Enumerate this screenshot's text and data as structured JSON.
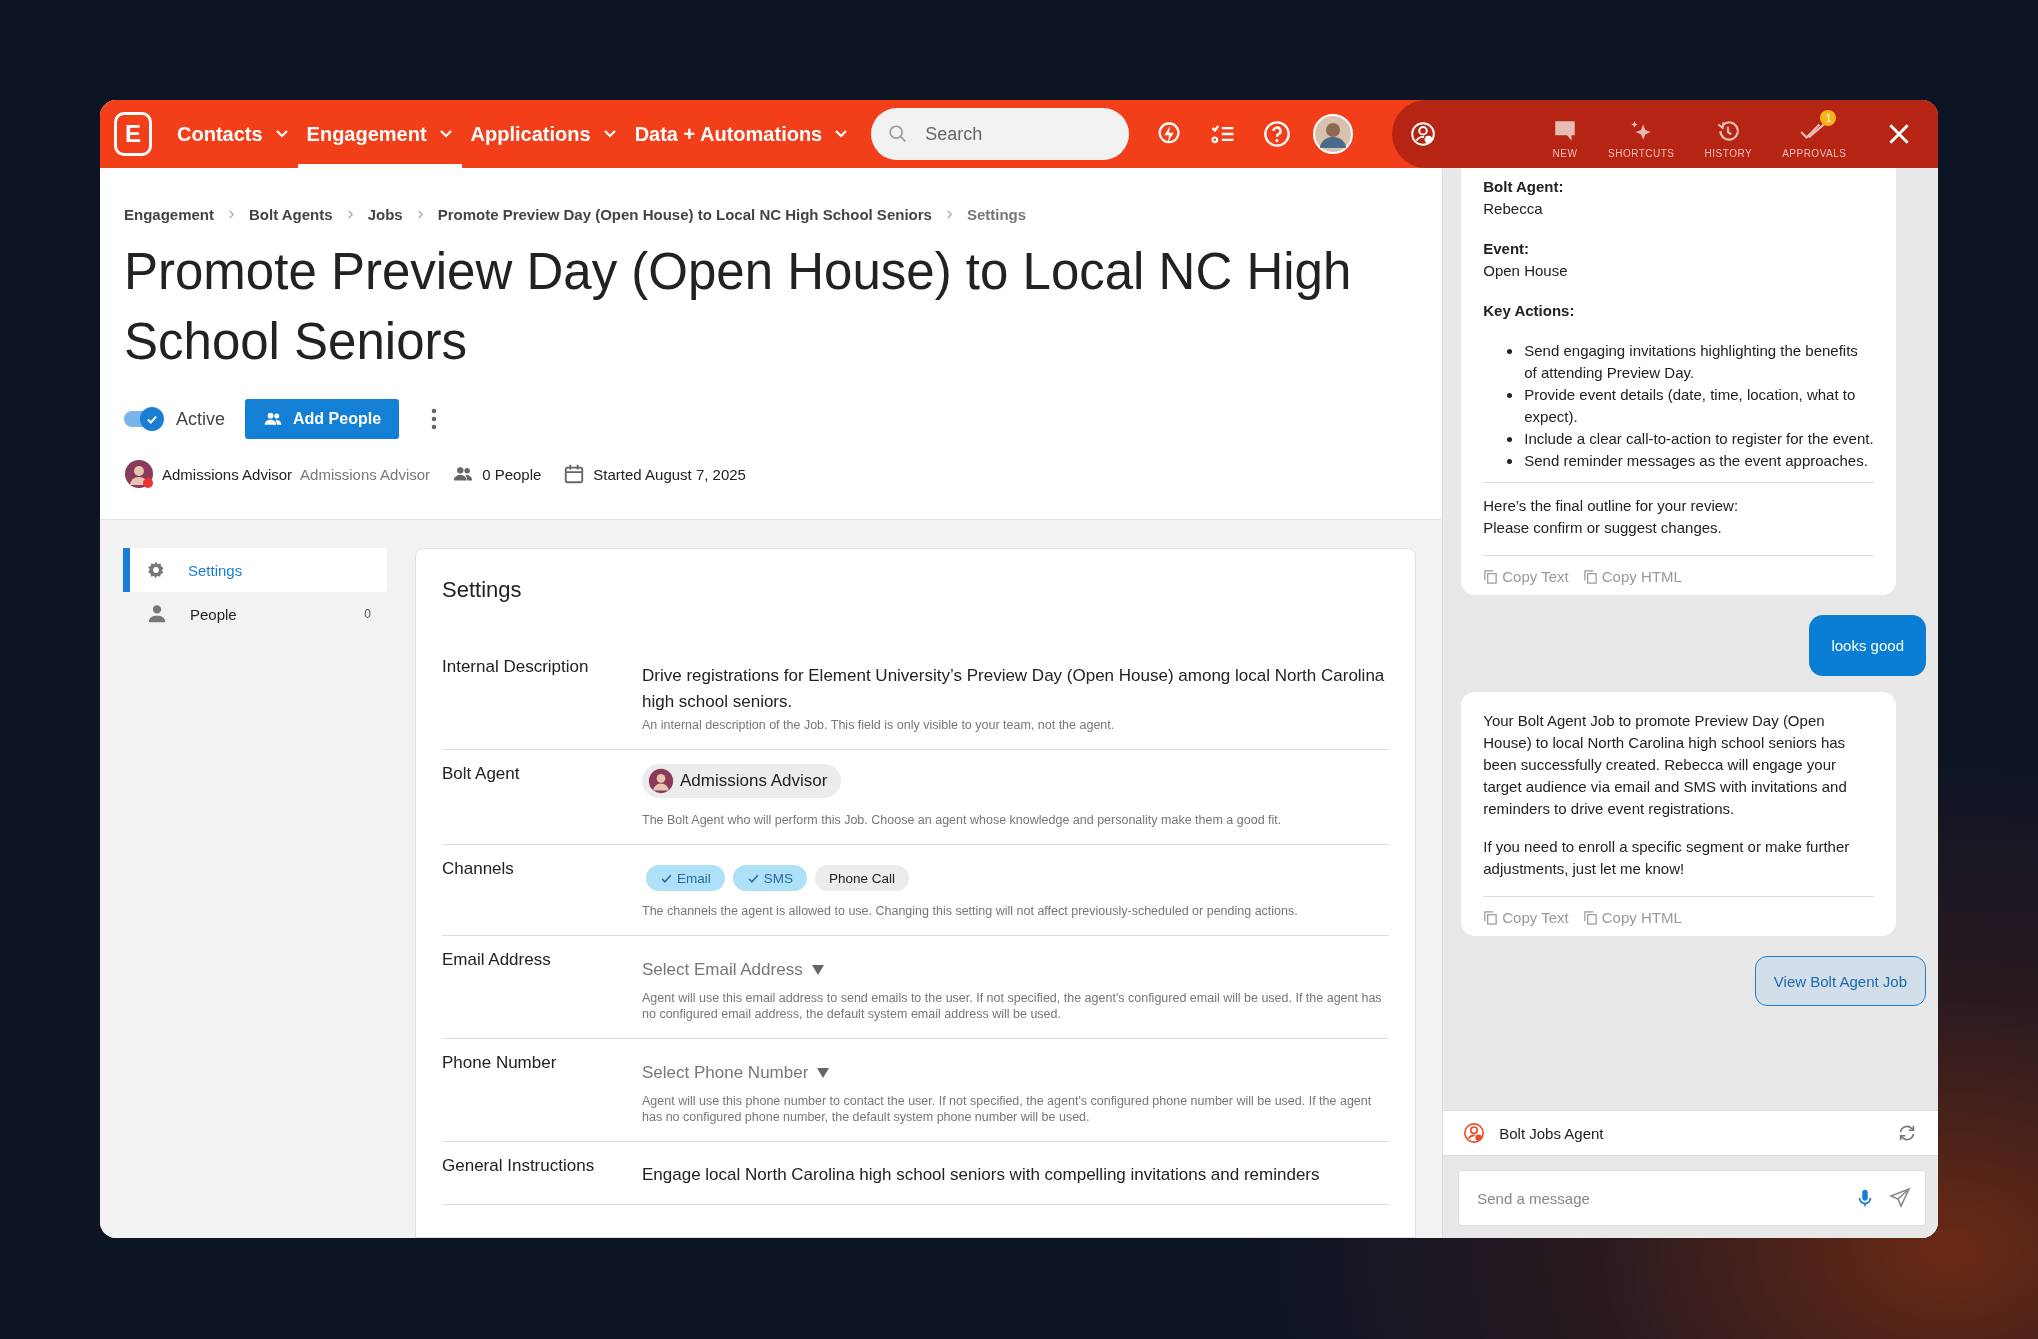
{
  "nav": {
    "logo": "E",
    "items": [
      {
        "label": "Contacts",
        "selected": false
      },
      {
        "label": "Engagement",
        "selected": true
      },
      {
        "label": "Applications",
        "selected": false
      },
      {
        "label": "Data + Automations",
        "selected": false
      }
    ],
    "search": {
      "placeholder": "Search"
    }
  },
  "assistant_header": {
    "tools": [
      {
        "label": "NEW",
        "kind": "new"
      },
      {
        "label": "SHORTCUTS",
        "kind": "shortcuts"
      },
      {
        "label": "HISTORY",
        "kind": "history"
      },
      {
        "label": "APPROVALS",
        "kind": "approvals",
        "badge": "1"
      }
    ]
  },
  "breadcrumbs": [
    "Engagement",
    "Bolt Agents",
    "Jobs",
    "Promote Preview Day (Open House) to Local NC High School Seniors",
    "Settings"
  ],
  "title": "Promote Preview Day (Open House) to Local NC High School Seniors",
  "active_toggle": {
    "label": "Active",
    "on": true
  },
  "add_people_button": "Add People",
  "meta": {
    "agent_name": "Admissions Advisor",
    "agent_role": "Admissions Advisor",
    "people": "0 People",
    "started": "Started August 7, 2025"
  },
  "sidebar": {
    "items": [
      {
        "label": "Settings",
        "kind": "settings",
        "selected": true
      },
      {
        "label": "People",
        "kind": "people",
        "count": "0",
        "selected": false
      }
    ]
  },
  "settings": {
    "title": "Settings",
    "rows": [
      {
        "label": "Internal Description",
        "kind": "text",
        "value": "Drive registrations for Element University’s Preview Day (Open House) among local North Carolina high school seniors.",
        "help": "An internal description of the Job. This field is only visible to your team, not the agent."
      },
      {
        "label": "Bolt Agent",
        "kind": "agent",
        "value": "Admissions Advisor",
        "help": "The Bolt Agent who will perform this Job. Choose an agent whose knowledge and personality make them a good fit."
      },
      {
        "label": "Channels",
        "kind": "channels",
        "channels": [
          {
            "label": "Email",
            "selected": true
          },
          {
            "label": "SMS",
            "selected": true
          },
          {
            "label": "Phone Call",
            "selected": false
          }
        ],
        "help": "The channels the agent is allowed to use. Changing this setting will not affect previously-scheduled or pending actions."
      },
      {
        "label": "Email Address",
        "kind": "select",
        "placeholder": "Select Email Address",
        "help": "Agent will use this email address to send emails to the user. If not specified, the agent's configured email will be used. If the agent has no configured email address, the default system email address will be used."
      },
      {
        "label": "Phone Number",
        "kind": "select",
        "placeholder": "Select Phone Number",
        "help": "Agent will use this phone number to contact the user. If not specified, the agent's configured phone number will be used. If the agent has no configured phone number, the default system phone number will be used."
      },
      {
        "label": "General Instructions",
        "kind": "text",
        "value": "Engage local North Carolina high school seniors with compelling invitations and reminders"
      }
    ]
  },
  "chat": {
    "messages": [
      {
        "kind": "agent",
        "sections": [
          [
            {
              "kind": "field",
              "label": "Bolt Agent:",
              "value": "Rebecca"
            },
            {
              "kind": "field",
              "label": "Event:",
              "value": "Open House"
            },
            {
              "kind": "heading",
              "text": "Key Actions:"
            },
            {
              "kind": "list",
              "items": [
                "Send engaging invitations highlighting the benefits of attending Preview Day.",
                "Provide event details (date, time, location, what to expect).",
                "Include a clear call-to-action to register for the event.",
                "Send reminder messages as the event approaches."
              ]
            }
          ],
          [
            {
              "kind": "paragraph",
              "text": "Here’s the final outline for your review:\nPlease confirm or suggest changes."
            }
          ]
        ],
        "actions": [
          "Copy Text",
          "Copy HTML"
        ]
      },
      {
        "kind": "user",
        "text": "looks good"
      },
      {
        "kind": "agent",
        "sections": [
          [
            {
              "kind": "paragraph",
              "text": "Your Bolt Agent Job to promote Preview Day (Open House) to local North Carolina high school seniors has been successfully created. Rebecca will engage your target audience via email and SMS with invitations and reminders to drive event registrations."
            },
            {
              "kind": "paragraph",
              "text": "If you need to enroll a specific segment or make further adjustments, just let me know!"
            }
          ]
        ],
        "actions": [
          "Copy Text",
          "Copy HTML"
        ]
      },
      {
        "kind": "action",
        "text": "View Bolt Agent Job"
      }
    ],
    "agent_bar": {
      "name": "Bolt Jobs Agent"
    },
    "composer": {
      "placeholder": "Send a message"
    }
  }
}
